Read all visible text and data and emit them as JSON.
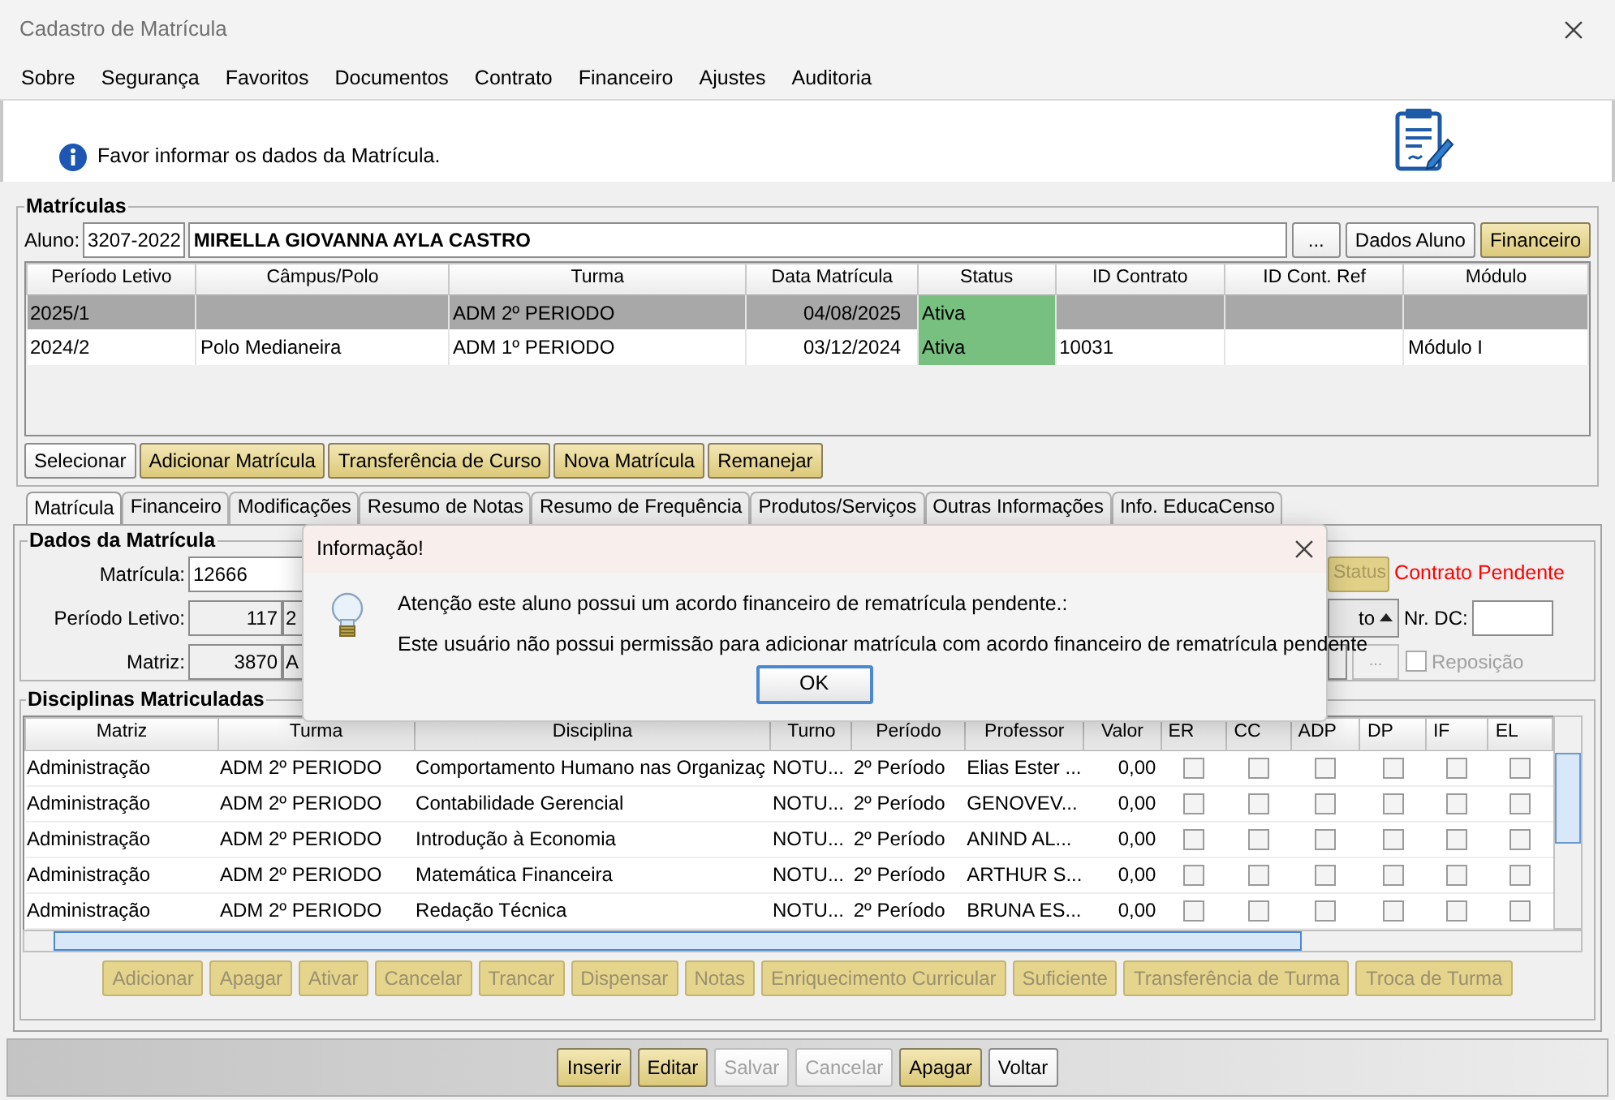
{
  "window": {
    "title": "Cadastro de Matrícula"
  },
  "menu": [
    "Sobre",
    "Segurança",
    "Favoritos",
    "Documentos",
    "Contrato",
    "Financeiro",
    "Ajustes",
    "Auditoria"
  ],
  "info": "Favor informar os dados da Matrícula.",
  "matriculas": {
    "title": "Matrículas",
    "aluno_label": "Aluno:",
    "aluno_code": "3207-2022",
    "aluno_name": "MIRELLA GIOVANNA AYLA CASTRO",
    "buttons": [
      {
        "label": "...",
        "kind": "plain"
      },
      {
        "label": "Dados Aluno",
        "kind": "plain"
      },
      {
        "label": "Financeiro",
        "kind": "yellow"
      }
    ],
    "columns": [
      "Período Letivo",
      "Câmpus/Polo",
      "Turma",
      "Data Matrícula",
      "Status",
      "ID Contrato",
      "ID Cont. Ref",
      "Módulo"
    ],
    "rows": [
      {
        "selected": true,
        "cells": [
          "2025/1",
          "",
          "ADM 2º PERIODO",
          "04/08/2025",
          "Ativa",
          "",
          "",
          ""
        ]
      },
      {
        "selected": false,
        "cells": [
          "2024/2",
          "Polo Medianeira",
          "ADM 1º PERIODO",
          "03/12/2024",
          "Ativa",
          "10031",
          "",
          "Módulo I"
        ]
      }
    ],
    "actions": [
      {
        "label": "Selecionar",
        "kind": "plain"
      },
      {
        "label": "Adicionar Matrícula",
        "kind": "yellow"
      },
      {
        "label": "Transferência de Curso",
        "kind": "yellow"
      },
      {
        "label": "Nova Matrícula",
        "kind": "yellow"
      },
      {
        "label": "Remanejar",
        "kind": "yellow"
      }
    ]
  },
  "tabs": [
    {
      "label": "Matrícula",
      "selected": true
    },
    {
      "label": "Financeiro",
      "selected": false
    },
    {
      "label": "Modificações",
      "selected": false
    },
    {
      "label": "Resumo de Notas",
      "selected": false
    },
    {
      "label": "Resumo de Frequência",
      "selected": false
    },
    {
      "label": "Produtos/Serviços",
      "selected": false
    },
    {
      "label": "Outras Informações",
      "selected": false
    },
    {
      "label": "Info. EducaCenso",
      "selected": false
    }
  ],
  "dados": {
    "title": "Dados da Matrícula",
    "fields": [
      {
        "label": "Matrícula:",
        "value": "12666"
      },
      {
        "label": "Período Letivo:",
        "value": "117",
        "extra": "2"
      },
      {
        "label": "Matriz:",
        "value": "3870",
        "extra": "A"
      }
    ],
    "status_button": "Status",
    "contract_status": "Contrato Pendente",
    "dropdown": "to",
    "nr_dc_label": "Nr. DC:",
    "more_button": "...",
    "reposicao": {
      "label": "Reposição",
      "checked": false
    }
  },
  "disciplinas": {
    "title": "Disciplinas Matriculadas",
    "columns": [
      "Matriz",
      "Turma",
      "Disciplina",
      "Turno",
      "Período",
      "Professor",
      "Valor",
      "ER",
      "CC",
      "ADP",
      "DP",
      "IF",
      "EL"
    ],
    "rows": [
      {
        "cells": [
          "Administração",
          "ADM 2º PERIODO",
          "Comportamento Humano nas Organizaç",
          "NOTU...",
          "2º Período",
          "Elias Ester ...",
          "0,00"
        ],
        "checks": [
          false,
          false,
          false,
          false,
          false,
          false
        ]
      },
      {
        "cells": [
          "Administração",
          "ADM 2º PERIODO",
          "Contabilidade Gerencial",
          "NOTU...",
          "2º Período",
          "GENOVEV...",
          "0,00"
        ],
        "checks": [
          false,
          false,
          false,
          false,
          false,
          false
        ]
      },
      {
        "cells": [
          "Administração",
          "ADM 2º PERIODO",
          "Introdução à Economia",
          "NOTU...",
          "2º Período",
          "ANIND AL...",
          "0,00"
        ],
        "checks": [
          false,
          false,
          false,
          false,
          false,
          false
        ]
      },
      {
        "cells": [
          "Administração",
          "ADM 2º PERIODO",
          "Matemática Financeira",
          "NOTU...",
          "2º Período",
          "ARTHUR S...",
          "0,00"
        ],
        "checks": [
          false,
          false,
          false,
          false,
          false,
          false
        ]
      },
      {
        "cells": [
          "Administração",
          "ADM 2º PERIODO",
          "Redação Técnica",
          "NOTU...",
          "2º Período",
          "BRUNA ES...",
          "0,00"
        ],
        "checks": [
          false,
          false,
          false,
          false,
          false,
          false
        ]
      }
    ],
    "actions": [
      {
        "label": "Adicionar",
        "disabled": true
      },
      {
        "label": "Apagar",
        "disabled": true
      },
      {
        "label": "Ativar",
        "disabled": true
      },
      {
        "label": "Cancelar",
        "disabled": true
      },
      {
        "label": "Trancar",
        "disabled": true
      },
      {
        "label": "Dispensar",
        "disabled": true
      },
      {
        "label": "Notas",
        "disabled": true
      },
      {
        "label": "Enriquecimento Curricular",
        "disabled": true
      },
      {
        "label": "Suficiente",
        "disabled": true
      },
      {
        "label": "Transferência de Turma",
        "disabled": true
      },
      {
        "label": "Troca de Turma",
        "disabled": true
      }
    ]
  },
  "footer": [
    {
      "label": "Inserir",
      "kind": "yellow",
      "disabled": false
    },
    {
      "label": "Editar",
      "kind": "yellow",
      "disabled": false
    },
    {
      "label": "Salvar",
      "kind": "plain",
      "disabled": true
    },
    {
      "label": "Cancelar",
      "kind": "plain",
      "disabled": true
    },
    {
      "label": "Apagar",
      "kind": "yellow",
      "disabled": false
    },
    {
      "label": "Voltar",
      "kind": "plain",
      "disabled": false
    }
  ],
  "dialog": {
    "title": "Informação!",
    "lines": [
      "Atenção este aluno possui um acordo financeiro de rematrícula pendente.:",
      "Este usuário não possui permissão para adicionar matrícula com acordo financeiro de rematrícula pendente"
    ],
    "button": "OK"
  }
}
